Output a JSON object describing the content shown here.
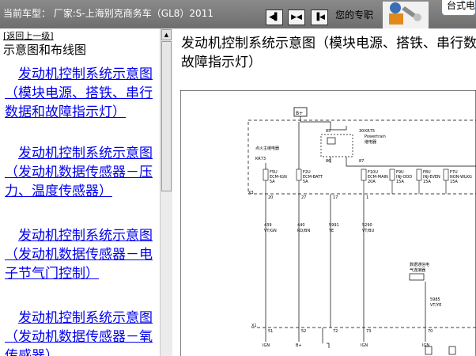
{
  "header": {
    "vehicle": "当前车型： 厂家:S-上海别克商务车（GL8）2011",
    "nav_icons": [
      "back-arrow-icon",
      "split-view-icon",
      "forward-arrow-icon"
    ],
    "help_text": "您的专职",
    "right_text": "台式电"
  },
  "sidebar": {
    "back_label": "[返回上一级]",
    "heading": "示意图和布线图",
    "links": [
      "发动机控制系统示意图（模块电源、搭铁、串行数据和故障指示灯）",
      "发动机控制系统示意图（发动机数据传感器－压力、温度传感器）",
      "发动机控制系统示意图（发动机数据传感器－电子节气门控制）",
      "发动机控制系统示意图（发动机数据传感器－氧传感器）"
    ]
  },
  "main": {
    "title": "发动机控制系统示意图（模块电源、搭铁、串行数据和故障指示灯）"
  },
  "diagram": {
    "b_plus": "B+",
    "relay_id": "KR75",
    "relay_name_en": "Powertrain",
    "relay_name_cn": "继电器",
    "relay_pins": [
      "85",
      "30",
      "86",
      "87"
    ],
    "ign_relay_label": "点火主继电器",
    "ign_relay_id": "KR73",
    "fuses": [
      {
        "id": "F5U",
        "name": "ECM-IGN",
        "amp": "5A"
      },
      {
        "id": "F2U",
        "name": "ECM-BATT",
        "amp": "5A"
      },
      {
        "id": "F10U",
        "name": "ECM-MAIN",
        "amp": "20A"
      },
      {
        "id": "F9U",
        "name": "INJ-ODD",
        "amp": "15A"
      },
      {
        "id": "F8U",
        "name": "INJ-EVEN",
        "amp": "15A"
      },
      {
        "id": "F7U",
        "name": "NON-WLKG",
        "amp": "15A"
      }
    ],
    "connector_x3": "X3",
    "x3_pins": [
      "20",
      "27",
      "17",
      "1"
    ],
    "wires": [
      {
        "circuit": "439",
        "color": "VT/GN"
      },
      {
        "circuit": "440",
        "color": "RD/BN"
      },
      {
        "circuit": "5991",
        "color": "YE"
      },
      {
        "circuit": "5290",
        "color": "VT/BU"
      }
    ],
    "datalink_label_1": "数据通信电",
    "datalink_label_2": "气连接器",
    "wire_right": {
      "circuit": "5985",
      "color": "VT/YE"
    },
    "connector_x1": "X1",
    "x1_pins": [
      "51",
      "52",
      "72",
      "73",
      "70"
    ],
    "bottom_labels": [
      "IGN",
      "B+",
      "IGN",
      "IGN"
    ]
  },
  "colors": {
    "header_bg": "#7b7b7b",
    "link": "#0000ee"
  }
}
